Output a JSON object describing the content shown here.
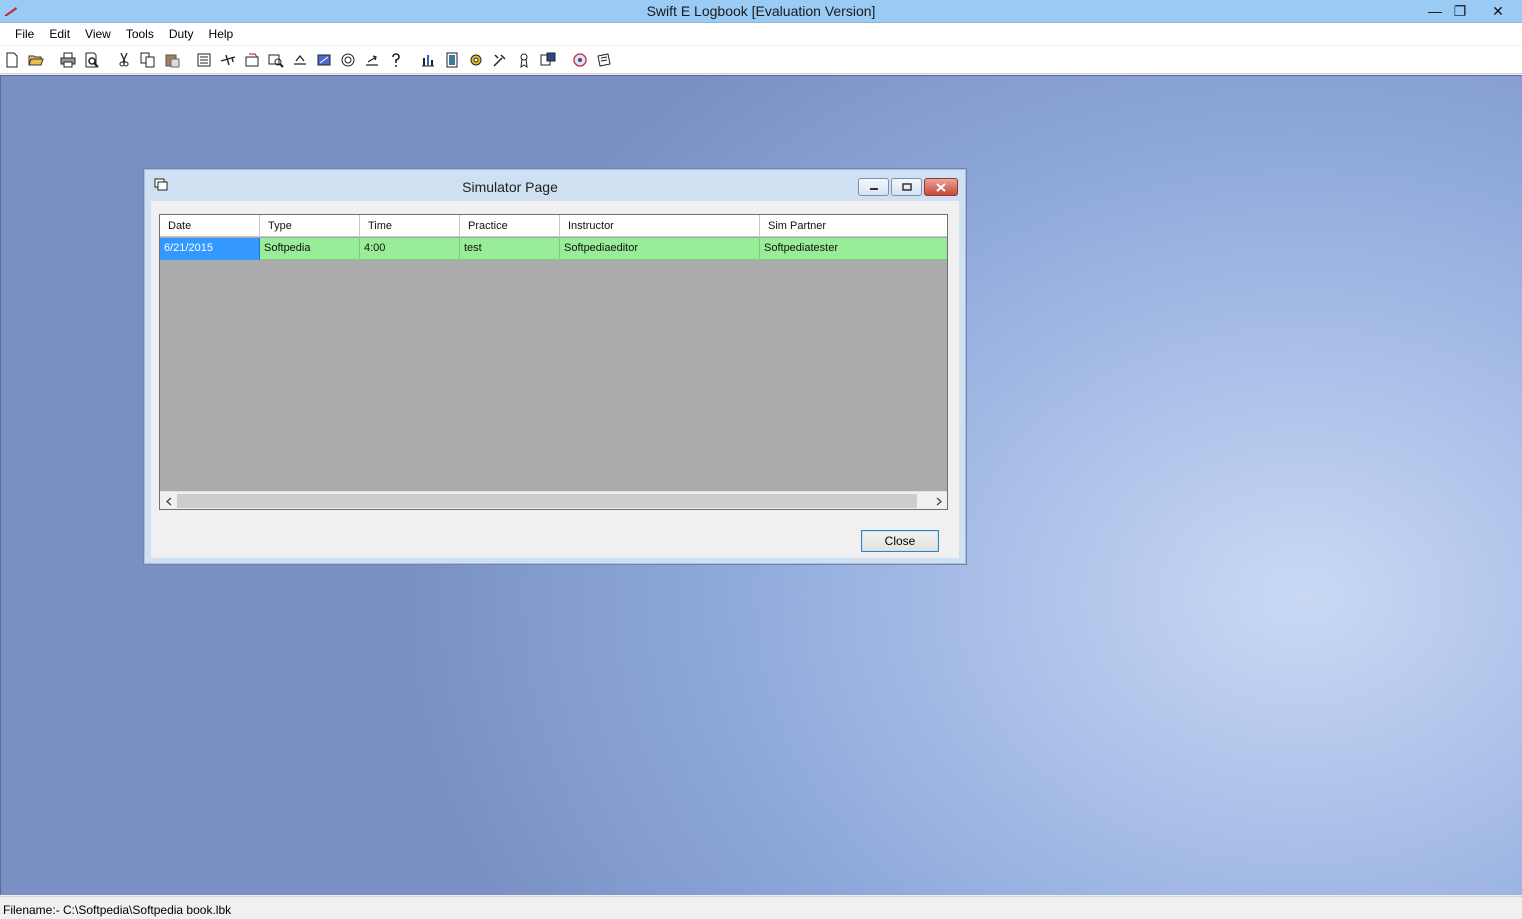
{
  "window": {
    "title": "Swift E Logbook [Evaluation Version]",
    "controls": {
      "minimize": "—",
      "maximize": "❐",
      "close": "✕"
    }
  },
  "menu": [
    "File",
    "Edit",
    "View",
    "Tools",
    "Duty",
    "Help"
  ],
  "toolbar": {
    "icons": [
      "new-file-icon",
      "open-folder-icon",
      "print-icon",
      "print-preview-icon",
      "cut-icon",
      "copy-icon",
      "paste-icon",
      "logbook-icon",
      "aircraft-icon",
      "flight-entry-icon",
      "search-record-icon",
      "import-icon",
      "simulator-icon",
      "duty-icon",
      "export-icon",
      "help-icon",
      "chart-icon",
      "report-icon",
      "settings-gear-icon",
      "tools-icon",
      "certificate-icon",
      "summary-icon",
      "web-icon",
      "notes-icon"
    ]
  },
  "dialog": {
    "title": "Simulator Page",
    "columns": [
      "Date",
      "Type",
      "Time",
      "Practice",
      "Instructor",
      "Sim Partner"
    ],
    "rows": [
      [
        "6/21/2015",
        "Softpedia",
        "4:00",
        "test",
        "Softpediaeditor",
        "Softpediatester"
      ]
    ],
    "close_label": "Close",
    "row_color": "#99ed99",
    "selected_color": "#3399ff"
  },
  "statusbar": {
    "text": "Filename:- C:\\Softpedia\\Softpedia book.lbk"
  }
}
